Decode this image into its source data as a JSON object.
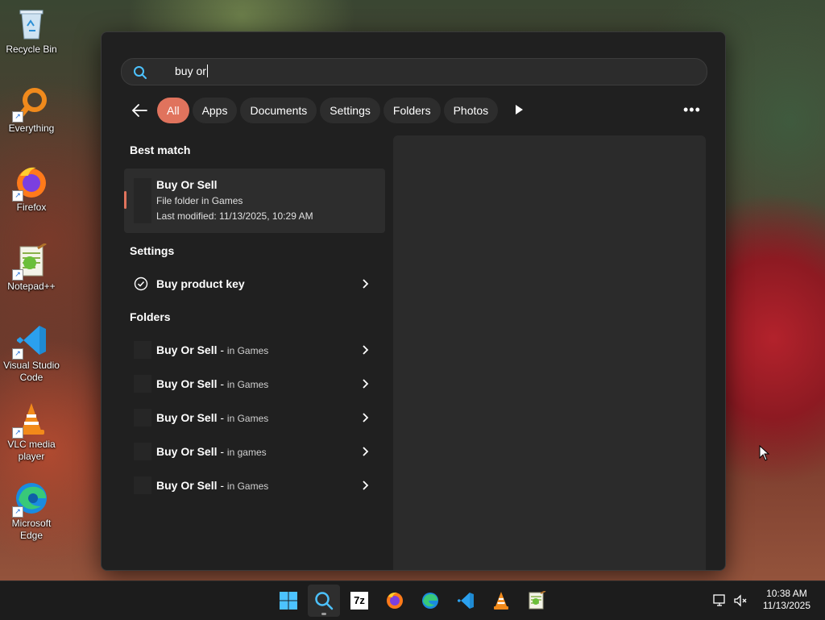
{
  "desktop": {
    "icons": [
      {
        "label": "Recycle Bin",
        "icon": "recycle-bin-icon"
      },
      {
        "label": "Everything",
        "icon": "everything-search-icon"
      },
      {
        "label": "Firefox",
        "icon": "firefox-icon"
      },
      {
        "label": "Notepad++",
        "icon": "notepadpp-icon"
      },
      {
        "label": "Visual Studio Code",
        "icon": "vscode-icon"
      },
      {
        "label": "VLC media player",
        "icon": "vlc-icon"
      },
      {
        "label": "Microsoft Edge",
        "icon": "edge-icon"
      }
    ]
  },
  "search": {
    "query": "buy or",
    "filters": [
      "All",
      "Apps",
      "Documents",
      "Settings",
      "Folders",
      "Photos"
    ],
    "active_filter": "All",
    "best_match_heading": "Best match",
    "best_match": {
      "title": "Buy Or Sell",
      "type": "File folder in Games",
      "modified": "Last modified: 11/13/2025, 10:29 AM"
    },
    "settings_heading": "Settings",
    "settings_items": [
      {
        "label": "Buy product key"
      }
    ],
    "folders_heading": "Folders",
    "folders": [
      {
        "name": "Buy Or Sell",
        "sep": " - ",
        "location": "in Games"
      },
      {
        "name": "Buy Or Sell",
        "sep": " - ",
        "location": "in Games"
      },
      {
        "name": "Buy Or Sell",
        "sep": " - ",
        "location": "in Games"
      },
      {
        "name": "Buy Or Sell",
        "sep": " - ",
        "location": "in games"
      },
      {
        "name": "Buy Or Sell",
        "sep": " - ",
        "location": "in Games"
      }
    ]
  },
  "taskbar": {
    "apps": [
      "start-icon",
      "search-icon",
      "7zip-icon",
      "firefox-icon",
      "edge-icon",
      "vscode-icon",
      "vlc-icon",
      "notepadpp-icon"
    ],
    "sevenzip_label": "7z",
    "time": "10:38 AM",
    "date": "11/13/2025"
  },
  "colors": {
    "accent": "#e0735d",
    "flyout_bg": "#202020",
    "taskbar_bg": "#1c1c1c"
  }
}
